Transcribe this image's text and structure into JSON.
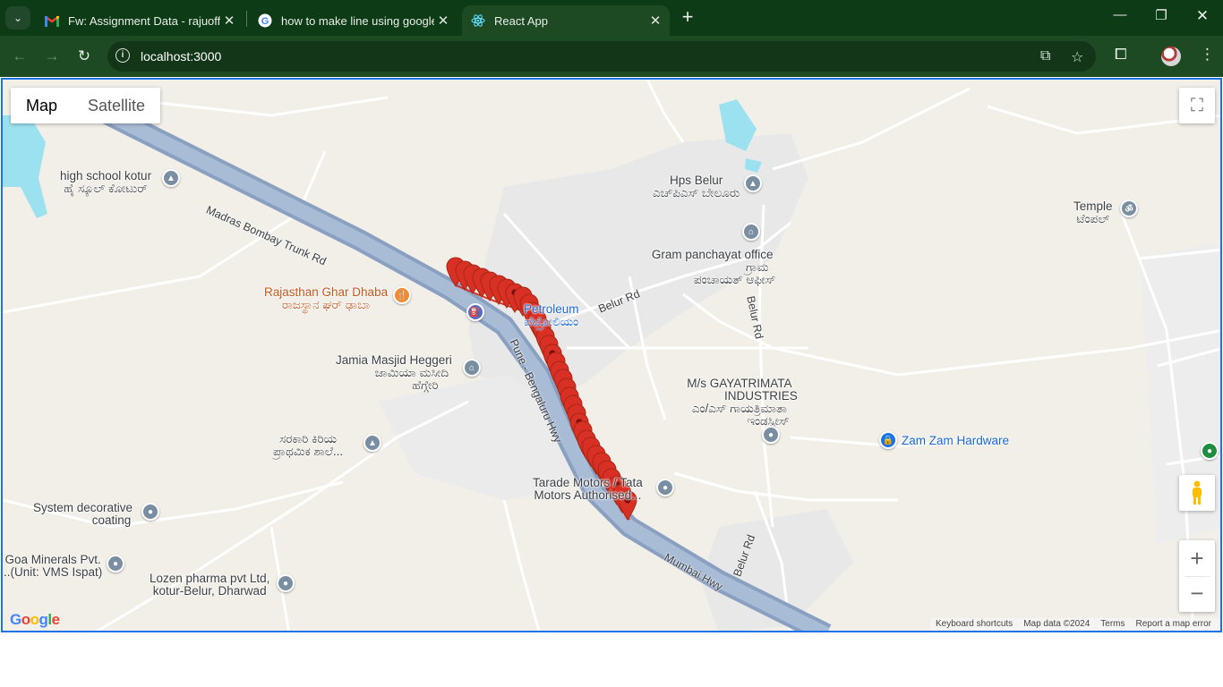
{
  "browser": {
    "tabs": [
      {
        "title": "Fw: Assignment Data - rajuofficial",
        "icon": "gmail-icon",
        "active": false
      },
      {
        "title": "how to make line using google",
        "icon": "google-icon",
        "active": false
      },
      {
        "title": "React App",
        "icon": "react-icon",
        "active": true
      }
    ],
    "address": "localhost:3000",
    "accent": "#0d3b16"
  },
  "map": {
    "map_type_options": [
      "Map",
      "Satellite"
    ],
    "selected_map_type": "Map",
    "place_labels": {
      "high_school": "high school kotur",
      "high_school_kn": "ಹೈ ಸ್ಕೂಲ್ ಕೋಟುರ್",
      "hps_belur": "Hps Belur",
      "hps_belur_kn": "ಎಚ್‌ಪಿಎಸ್ ಬೇಲೂರು",
      "temple": "Temple",
      "temple_kn": "ಟೆಂಪಲ್",
      "gram_panchayat": "Gram panchayat office",
      "gram_panchayat_kn1": "ಗ್ರಾಮ",
      "gram_panchayat_kn2": "ಪಂಚಾಯತ್ ಆಫೀಸ್",
      "dhaba": "Rajasthan Ghar Dhaba",
      "dhaba_kn": "ರಾಜಸ್ಥಾನ ಘರ್ ಢಾಬಾ",
      "petroleum": "Petroleum",
      "petroleum_kn": "ಪೆಟ್ರೋಲಿಯಂ",
      "jamia": "Jamia Masjid Heggeri",
      "jamia_kn1": "ಜಾಮಿಯಾ ಮಸೀದಿ",
      "jamia_kn2": "ಹೆಗ್ಗೇರಿ",
      "gayatrimata1": "M/s GAYATRIMATA",
      "gayatrimata2": "INDUSTRIES",
      "gayatrimata_kn1": "ಎಂ/ಎಸ್ ಗಾಯತ್ರಿಮಾತಾ",
      "gayatrimata_kn2": "ಇಂಡಸ್ಟ್ರೀಸ್",
      "zamzam": "Zam Zam Hardware",
      "sarkari_kn1": "ಸರಕಾರಿ ಕಿರಿಯ",
      "sarkari_kn2": "ಪ್ರಾಥಮಿಕ ಶಾಲೆ...",
      "tarade1": "Tarade Motors / Tata",
      "tarade2": "Motors Authorised...",
      "system_decorative1": "System decorative",
      "system_decorative2": "coating",
      "goa_minerals1": "Goa Minerals Pvt.",
      "goa_minerals2": "..(Unit: VMS Ispat)",
      "lozen1": "Lozen pharma pvt Ltd,",
      "lozen2": "kotur-Belur, Dharwad"
    },
    "road_labels": {
      "madras": "Madras Bombay Trunk Rd",
      "belur_rd_1": "Belur Rd",
      "belur_rd_2": "Belur Rd",
      "belur_rd_3": "Belur Rd",
      "pune": "Pune - Bengaluru Hwy",
      "mumbai": "Mumbai Hwy"
    },
    "attribution": [
      "Keyboard shortcuts",
      "Map data ©2024",
      "Terms",
      "Report a map error"
    ],
    "logo": "Google",
    "marker_color": "#d93025",
    "marker_count": 34
  }
}
